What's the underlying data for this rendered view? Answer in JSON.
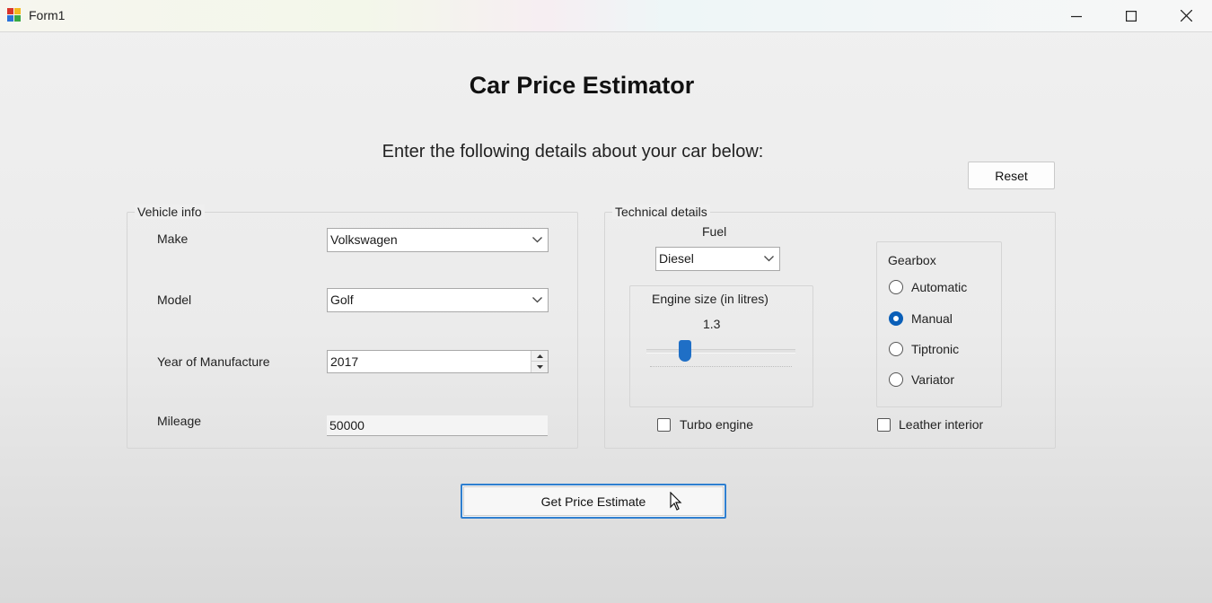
{
  "window": {
    "title": "Form1"
  },
  "page": {
    "heading": "Car Price Estimator",
    "subheading": "Enter the following details about your car below:",
    "reset_label": "Reset",
    "estimate_label": "Get Price Estimate"
  },
  "vehicle_info": {
    "group_label": "Vehicle info",
    "make_label": "Make",
    "make_value": "Volkswagen",
    "model_label": "Model",
    "model_value": "Golf",
    "year_label": "Year of Manufacture",
    "year_value": "2017",
    "mileage_label": "Mileage",
    "mileage_value": "50000"
  },
  "technical": {
    "group_label": "Technical details",
    "fuel_label": "Fuel",
    "fuel_value": "Diesel",
    "engine_label": "Engine size (in litres)",
    "engine_value": "1.3",
    "engine_slider_fraction": 0.24,
    "gearbox_label": "Gearbox",
    "gearbox_options": [
      "Automatic",
      "Manual",
      "Tiptronic",
      "Variator"
    ],
    "gearbox_selected": "Manual",
    "turbo_label": "Turbo engine",
    "turbo_checked": false,
    "leather_label": "Leather interior",
    "leather_checked": false
  },
  "icons": {
    "app": "form-app-icon",
    "minimize": "minimize-icon",
    "maximize": "maximize-icon",
    "close": "close-icon",
    "dropdown": "chevron-down-icon",
    "cursor": "mouse-pointer-icon"
  },
  "colors": {
    "accent": "#1f6fc6",
    "button_focus_border": "#2f7fd0"
  }
}
